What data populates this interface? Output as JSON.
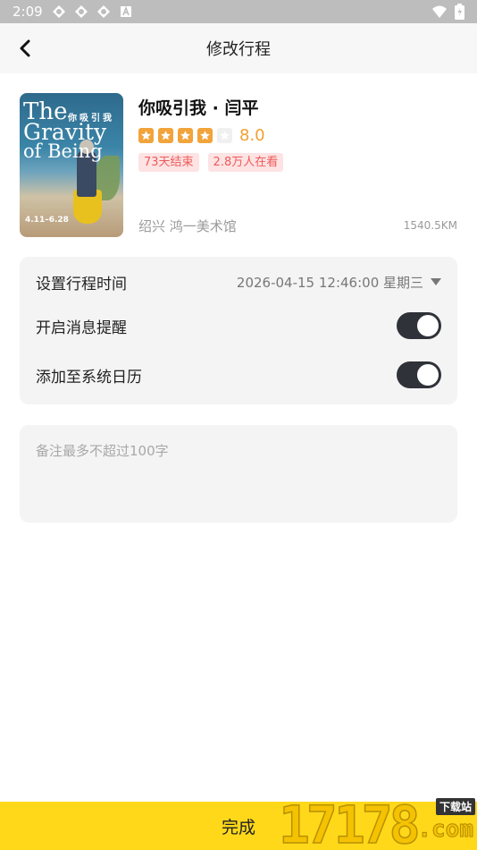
{
  "status_bar": {
    "time": "2:09",
    "icons": [
      "app-icon",
      "app-icon",
      "app-icon",
      "font-icon",
      "wifi-icon",
      "battery-icon"
    ]
  },
  "header": {
    "title": "修改行程",
    "back_icon": "chevron-left-icon"
  },
  "event": {
    "poster": {
      "title_line1": "The",
      "title_line2": "Gravity",
      "title_line3": "of Being",
      "chinese_title": "你吸引我",
      "date_text": "4.11–6.28"
    },
    "title": "你吸引我 · 闫平",
    "rating": {
      "stars_filled": 4,
      "stars_total": 5,
      "score": "8.0"
    },
    "tags": [
      "73天结束",
      "2.8万人在看"
    ],
    "venue": "绍兴  鸿一美术馆",
    "distance": "1540.5KM"
  },
  "settings": {
    "time_label": "设置行程时间",
    "time_value": "2026-04-15 12:46:00 星期三",
    "reminder_label": "开启消息提醒",
    "reminder_on": true,
    "calendar_label": "添加至系统日历",
    "calendar_on": true
  },
  "remarks": {
    "placeholder": "备注最多不超过100字",
    "value": ""
  },
  "footer": {
    "done_label": "完成"
  },
  "watermark": {
    "digits": "17178",
    "sub": "下载站",
    "com": ".com"
  },
  "colors": {
    "accent_yellow": "#ffd81a",
    "star_orange": "#f2a33a",
    "tag_red": "#f05a5a",
    "tag_bg": "#fde3e3",
    "toggle_on": "#2f3238"
  }
}
